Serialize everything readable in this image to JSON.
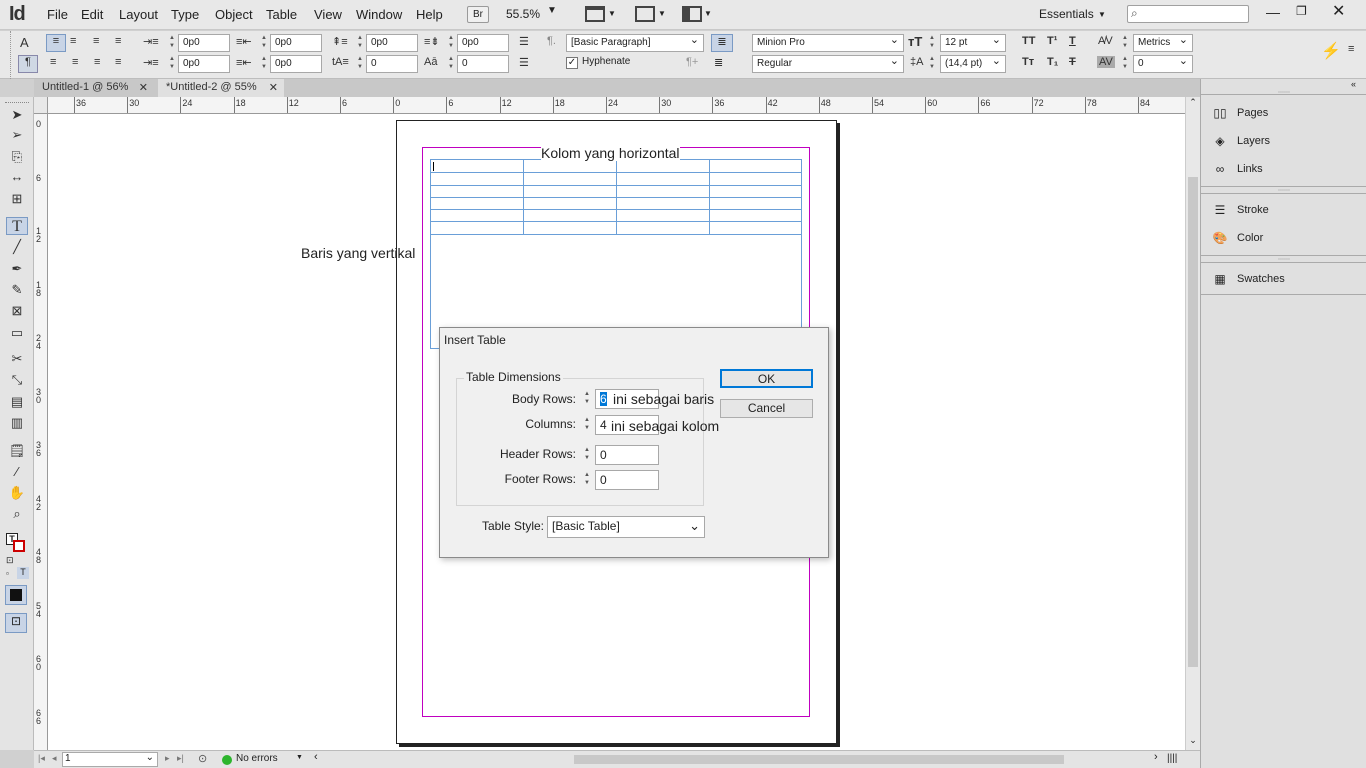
{
  "app": {
    "logo": "Id",
    "br_label": "Br",
    "zoom": "55.5%",
    "workspace": "Essentials",
    "search_placeholder": ""
  },
  "menu": [
    "File",
    "Edit",
    "Layout",
    "Type",
    "Object",
    "Table",
    "View",
    "Window",
    "Help"
  ],
  "control": {
    "indent_left": "0p0",
    "indent_right": "0p0",
    "space_before": "0p0",
    "space_after": "0p0",
    "first_line": "0p0",
    "last_line": "0p0",
    "drop_cap_lines": "0",
    "drop_cap_chars": "0",
    "para_style": "[Basic Paragraph]",
    "hyphenate": "Hyphenate",
    "font": "Minion Pro",
    "font_style": "Regular",
    "font_size": "12 pt",
    "leading": "(14,4 pt)",
    "kerning": "Metrics",
    "tracking": "0"
  },
  "tabs": [
    {
      "label": "Untitled-1 @ 56%",
      "active": false
    },
    {
      "label": "*Untitled-2 @ 55%",
      "active": true
    }
  ],
  "hruler": [
    "36",
    "30",
    "24",
    "18",
    "12",
    "6",
    "0",
    "6",
    "12",
    "18",
    "24",
    "30",
    "36",
    "42",
    "48",
    "54",
    "60",
    "66",
    "72",
    "78",
    "84"
  ],
  "vruler": [
    "0",
    "6",
    "12",
    "18",
    "24",
    "30",
    "36",
    "42",
    "48",
    "54",
    "60",
    "66"
  ],
  "annotations": {
    "kolom": "Kolom yang horizontal",
    "baris": "Baris yang vertikal"
  },
  "panels": [
    {
      "label": "Pages",
      "icon": "pages-icon"
    },
    {
      "label": "Layers",
      "icon": "layers-icon"
    },
    {
      "label": "Links",
      "icon": "links-icon"
    },
    {
      "label": "Stroke",
      "icon": "stroke-icon"
    },
    {
      "label": "Color",
      "icon": "color-icon"
    },
    {
      "label": "Swatches",
      "icon": "swatches-icon"
    }
  ],
  "status": {
    "page": "1",
    "errors": "No errors"
  },
  "dialog": {
    "title": "Insert Table",
    "group": "Table Dimensions",
    "body_rows_label": "Body Rows:",
    "body_rows": "6",
    "body_rows_note": "ini sebagai baris",
    "columns_label": "Columns:",
    "columns": "4",
    "columns_note": "ini sebagai kolom",
    "header_rows_label": "Header Rows:",
    "header_rows": "0",
    "footer_rows_label": "Footer Rows:",
    "footer_rows": "0",
    "table_style_label": "Table Style:",
    "table_style": "[Basic Table]",
    "ok": "OK",
    "cancel": "Cancel"
  },
  "colors": {
    "accent": "#0078d7",
    "margin": "#c000c0",
    "frame": "#6a9fd8"
  }
}
